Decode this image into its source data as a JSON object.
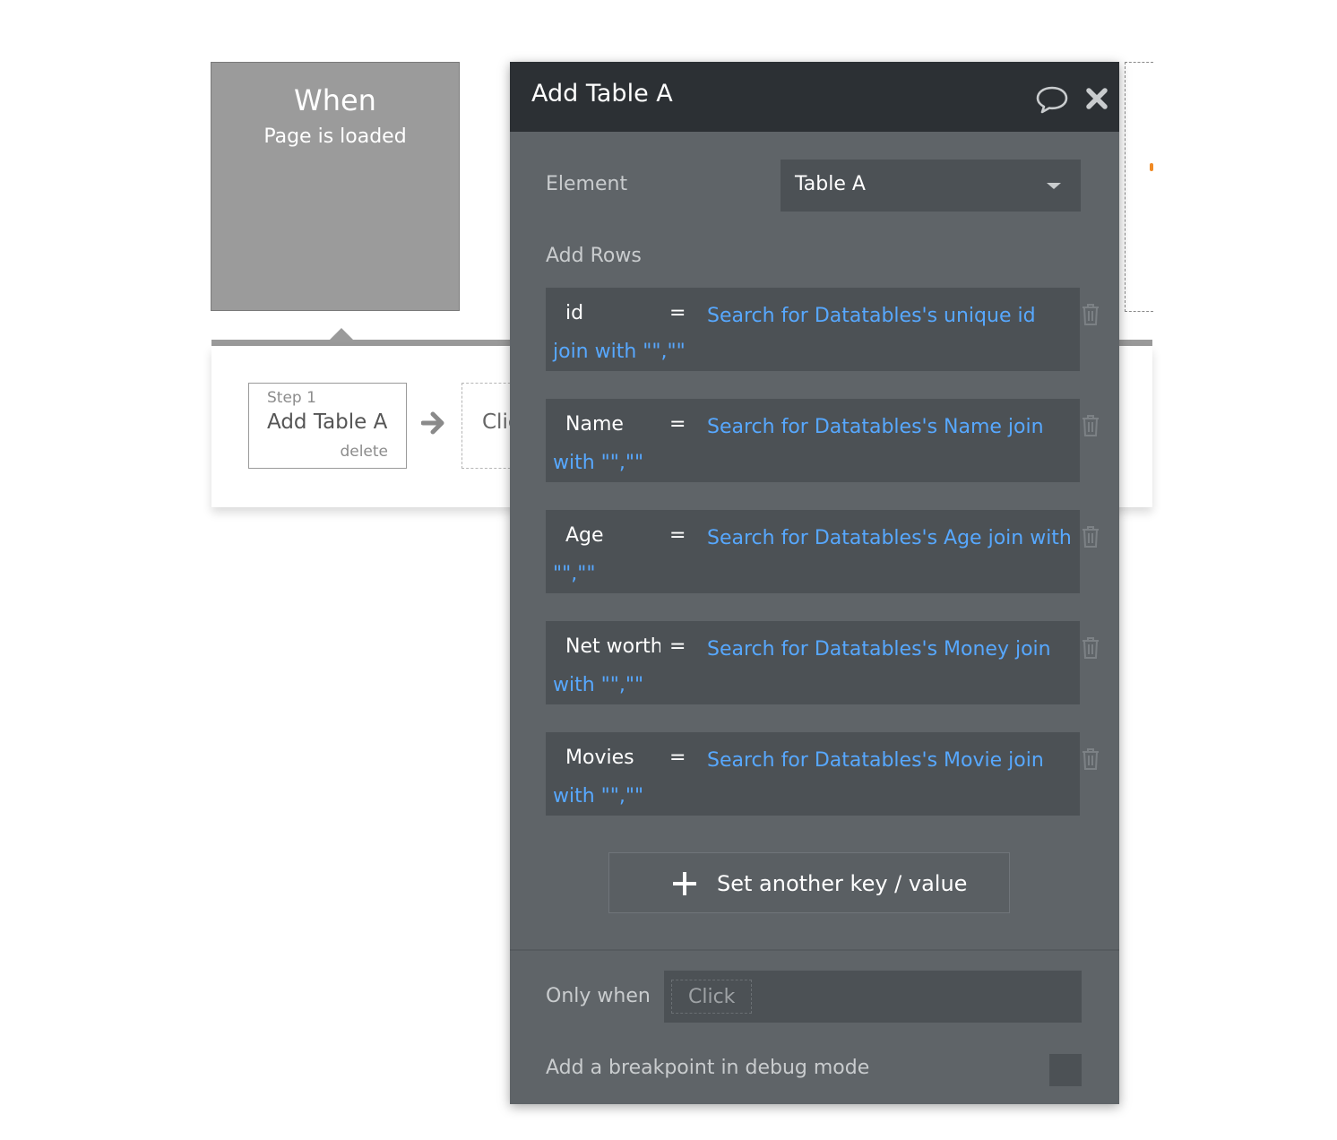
{
  "trigger": {
    "title": "When",
    "subtitle": "Page is loaded"
  },
  "workflow": {
    "step_number": "Step 1",
    "step_title": "Add Table A",
    "step_delete": "delete",
    "next_step_partial": "Click"
  },
  "panel": {
    "title": "Add Table A",
    "icons": {
      "comment": "comment-icon",
      "close": "close-icon",
      "trash": "trash-icon",
      "plus": "plus-icon"
    },
    "element_label": "Element",
    "element_value": "Table A",
    "add_rows_label": "Add Rows",
    "rows": [
      {
        "key": "id",
        "eq": "=",
        "value": "Search for Datatables's unique id join with \"\",\"\""
      },
      {
        "key": "Name",
        "eq": "=",
        "value": "Search for Datatables's Name join with \"\",\"\""
      },
      {
        "key": "Age",
        "eq": "=",
        "value": "Search for Datatables's Age join with \"\",\"\""
      },
      {
        "key": "Net worth",
        "eq": "=",
        "value": "Search for Datatables's Money join with \"\",\"\""
      },
      {
        "key": "Movies",
        "eq": "=",
        "value": "Search for Datatables's Movie join with \"\",\"\""
      }
    ],
    "add_button_label": "Set another key / value",
    "only_when_label": "Only when",
    "only_when_value": "Click",
    "breakpoint_label": "Add a breakpoint in debug mode"
  }
}
